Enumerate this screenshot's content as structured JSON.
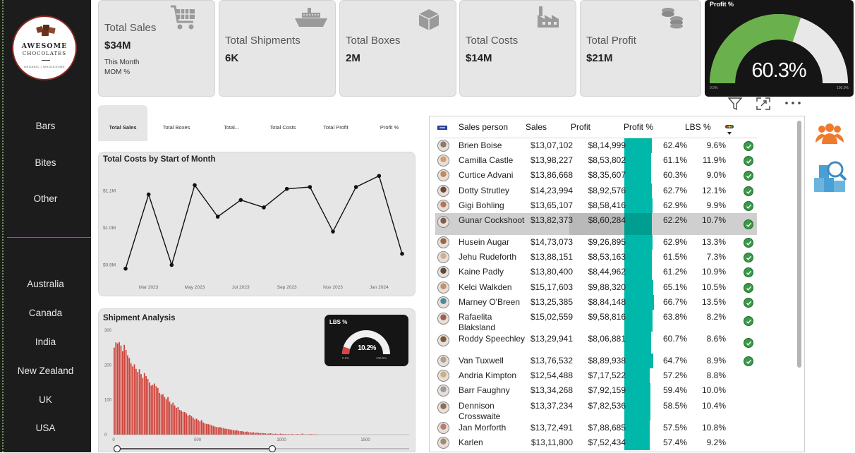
{
  "sidebar": {
    "logo_name": "AWESOME",
    "logo_name2": "CHOCOLATES",
    "logo_tagline": "ORGANIC • WHOLESOME",
    "categories": [
      "Bars",
      "Bites",
      "Other"
    ],
    "countries": [
      "Australia",
      "Canada",
      "India",
      "New Zealand",
      "UK",
      "USA"
    ]
  },
  "kpis": {
    "sales": {
      "label": "Total Sales",
      "value": "$34M",
      "sub1": "This Month",
      "sub2": "MOM %"
    },
    "shipments": {
      "label": "Total Shipments",
      "value": "6K"
    },
    "boxes": {
      "label": "Total Boxes",
      "value": "2M"
    },
    "costs": {
      "label": "Total Costs",
      "value": "$14M"
    },
    "profit": {
      "label": "Total Profit",
      "value": "$21M"
    }
  },
  "profit_gauge": {
    "title": "Profit %",
    "value_label": "60.3%",
    "value": 60.3,
    "min_label": "0.0%",
    "max_label": "100.0%"
  },
  "tabs": [
    "Total Sales",
    "Total Boxes",
    "Total...",
    "Total Costs",
    "Total Profit",
    "Profit %"
  ],
  "line_chart": {
    "title": "Total Costs by Start of Month",
    "ytick_labels": [
      "$1.1M",
      "$1.0M",
      "$0.9M"
    ],
    "xtick_labels": [
      "Mar 2023",
      "May 2023",
      "Jul 2023",
      "Sep 2023",
      "Nov 2023",
      "Jan 2024"
    ]
  },
  "shipment": {
    "title": "Shipment Analysis",
    "ytick_labels": [
      "300",
      "200",
      "100",
      "0"
    ],
    "xtick_labels": [
      "0",
      "500",
      "1000",
      "1500"
    ]
  },
  "lbs_gauge": {
    "title": "LBS %",
    "value_label": "10.2%",
    "value": 10.2,
    "min_label": "0.0%",
    "max_label": "100.0%"
  },
  "table": {
    "headers": [
      "Sales person",
      "Sales",
      "Profit",
      "Profit %",
      "LBS %"
    ],
    "rows": [
      {
        "name": "Brien Boise",
        "sales": "$13,07,102",
        "profit": "$8,14,999",
        "pct": "62.4%",
        "lbs": "9.6%",
        "ok": true
      },
      {
        "name": "Camilla Castle",
        "sales": "$13,98,227",
        "profit": "$8,53,802",
        "pct": "61.1%",
        "lbs": "11.9%",
        "ok": true
      },
      {
        "name": "Curtice Advani",
        "sales": "$13,86,668",
        "profit": "$8,35,607",
        "pct": "60.3%",
        "lbs": "9.0%",
        "ok": true
      },
      {
        "name": "Dotty Strutley",
        "sales": "$14,23,994",
        "profit": "$8,92,576",
        "pct": "62.7%",
        "lbs": "12.1%",
        "ok": true
      },
      {
        "name": "Gigi Bohling",
        "sales": "$13,65,107",
        "profit": "$8,58,416",
        "pct": "62.9%",
        "lbs": "9.9%",
        "ok": true
      },
      {
        "name": "Gunar Cockshoot",
        "sales": "$13,82,373",
        "profit": "$8,60,284",
        "pct": "62.2%",
        "lbs": "10.7%",
        "ok": true,
        "selected": true
      },
      {
        "name": "Husein Augar",
        "sales": "$14,73,073",
        "profit": "$9,26,895",
        "pct": "62.9%",
        "lbs": "13.3%",
        "ok": true
      },
      {
        "name": "Jehu Rudeforth",
        "sales": "$13,88,151",
        "profit": "$8,53,163",
        "pct": "61.5%",
        "lbs": "7.3%",
        "ok": true
      },
      {
        "name": "Kaine Padly",
        "sales": "$13,80,400",
        "profit": "$8,44,962",
        "pct": "61.2%",
        "lbs": "10.9%",
        "ok": true
      },
      {
        "name": "Kelci Walkden",
        "sales": "$15,17,603",
        "profit": "$9,88,320",
        "pct": "65.1%",
        "lbs": "10.5%",
        "ok": true
      },
      {
        "name": "Marney O'Breen",
        "sales": "$13,25,385",
        "profit": "$8,84,148",
        "pct": "66.7%",
        "lbs": "13.5%",
        "ok": true
      },
      {
        "name": "Rafaelita Blaksland",
        "sales": "$15,02,559",
        "profit": "$9,58,816",
        "pct": "63.8%",
        "lbs": "8.2%",
        "ok": true
      },
      {
        "name": "Roddy Speechley",
        "sales": "$13,29,941",
        "profit": "$8,06,881",
        "pct": "60.7%",
        "lbs": "8.6%",
        "ok": true
      },
      {
        "name": "Van Tuxwell",
        "sales": "$13,76,532",
        "profit": "$8,89,938",
        "pct": "64.7%",
        "lbs": "8.9%",
        "ok": true
      },
      {
        "name": "Andria Kimpton",
        "sales": "$12,54,488",
        "profit": "$7,17,522",
        "pct": "57.2%",
        "lbs": "8.8%",
        "ok": false
      },
      {
        "name": "Barr Faughny",
        "sales": "$13,34,268",
        "profit": "$7,92,159",
        "pct": "59.4%",
        "lbs": "10.0%",
        "ok": false
      },
      {
        "name": "Dennison Crosswaite",
        "sales": "$13,37,234",
        "profit": "$7,82,536",
        "pct": "58.5%",
        "lbs": "10.4%",
        "ok": false
      },
      {
        "name": "Jan Morforth",
        "sales": "$13,72,491",
        "profit": "$7,88,685",
        "pct": "57.5%",
        "lbs": "10.8%",
        "ok": false
      },
      {
        "name": "Karlen",
        "sales": "$13,11,800",
        "profit": "$7,52,434",
        "pct": "57.4%",
        "lbs": "9.2%",
        "ok": false
      }
    ]
  },
  "chart_data": [
    {
      "type": "line",
      "title": "Total Costs by Start of Month",
      "x": [
        "Feb 2023",
        "Mar 2023",
        "Apr 2023",
        "May 2023",
        "Jun 2023",
        "Jul 2023",
        "Aug 2023",
        "Sep 2023",
        "Oct 2023",
        "Nov 2023",
        "Dec 2023",
        "Jan 2024",
        "Feb 2024"
      ],
      "values": [
        0.89,
        1.09,
        0.9,
        1.115,
        1.03,
        1.075,
        1.055,
        1.105,
        1.11,
        0.99,
        1.11,
        1.14,
        0.93
      ],
      "ylim": [
        0.88,
        1.15
      ],
      "grid": false
    },
    {
      "type": "bar",
      "title": "Shipment Analysis",
      "bin_width": 10,
      "x_start": 0,
      "values": [
        250,
        265,
        262,
        266,
        256,
        240,
        258,
        243,
        228,
        220,
        205,
        196,
        202,
        189,
        180,
        188,
        174,
        163,
        177,
        168,
        160,
        150,
        141,
        143,
        147,
        139,
        134,
        120,
        115,
        116,
        108,
        102,
        108,
        95,
        87,
        92,
        84,
        77,
        79,
        71,
        69,
        65,
        65,
        61,
        55,
        57,
        53,
        49,
        44,
        46,
        42,
        38,
        42,
        35,
        32,
        31,
        30,
        29,
        27,
        25,
        23,
        22,
        21,
        22,
        20,
        19,
        17,
        17,
        16,
        15,
        14,
        13,
        12,
        13,
        11,
        10,
        10,
        9,
        8,
        9,
        7,
        7,
        6,
        7,
        5,
        6,
        5,
        4,
        5,
        4,
        4,
        3,
        3,
        4,
        3,
        2,
        3,
        2,
        2,
        3,
        2,
        2,
        2,
        1,
        2,
        1,
        2,
        1,
        1,
        2,
        1,
        1,
        3,
        1,
        1,
        1,
        1,
        2,
        1,
        1,
        1,
        1
      ],
      "xlim": [
        0,
        1760
      ],
      "ylim": [
        0,
        300
      ]
    }
  ]
}
